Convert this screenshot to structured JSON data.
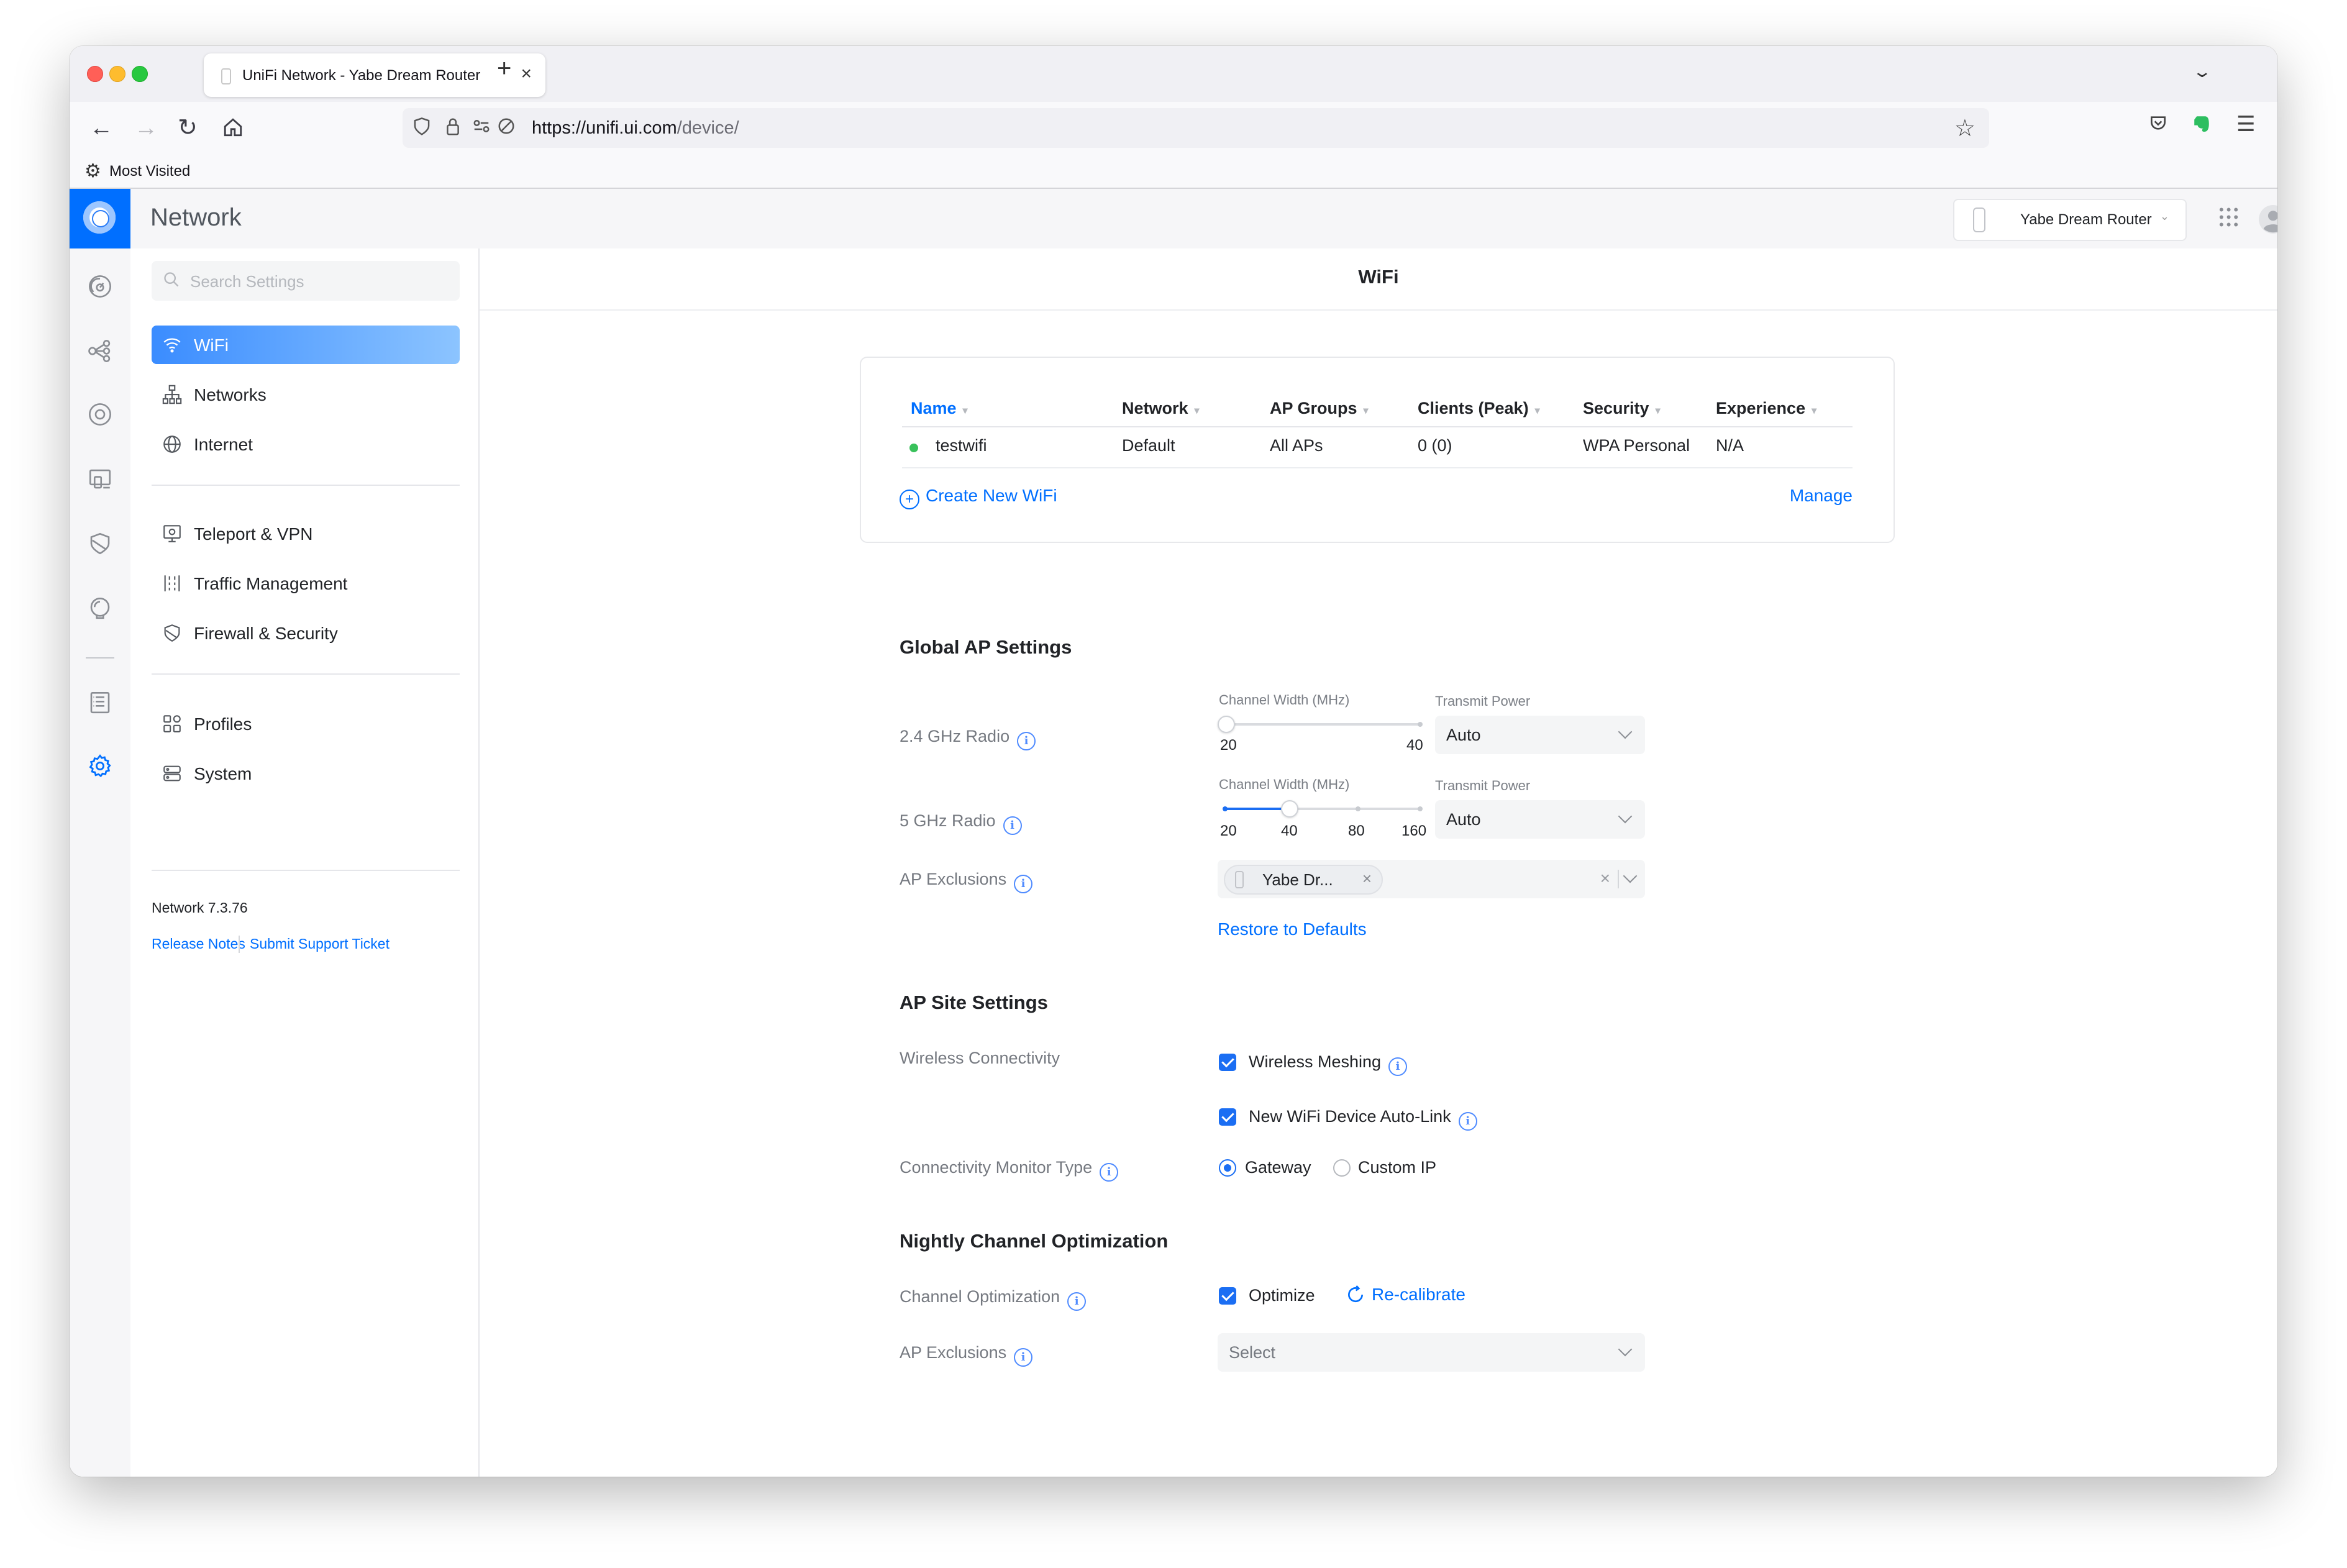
{
  "browser": {
    "tab_title": "UniFi Network - Yabe Dream Router",
    "url_host": "https://unifi.ui.com",
    "url_path": "/device/",
    "bookmark_label": "Most Visited"
  },
  "app": {
    "title": "Network",
    "device_name": "Yabe Dream Router",
    "accent_color": "#006fff"
  },
  "sidebar": {
    "search_placeholder": "Search Settings",
    "items": [
      {
        "label": "WiFi",
        "icon": "wifi-icon"
      },
      {
        "label": "Networks",
        "icon": "networks-icon"
      },
      {
        "label": "Internet",
        "icon": "globe-icon"
      },
      {
        "label": "Teleport & VPN",
        "icon": "teleport-icon"
      },
      {
        "label": "Traffic Management",
        "icon": "traffic-icon"
      },
      {
        "label": "Firewall & Security",
        "icon": "shield-icon"
      },
      {
        "label": "Profiles",
        "icon": "profiles-icon"
      },
      {
        "label": "System",
        "icon": "system-icon"
      }
    ],
    "version": "Network 7.3.76",
    "release_notes": "Release Notes",
    "support_ticket": "Submit Support Ticket"
  },
  "page": {
    "title": "WiFi"
  },
  "wifi_table": {
    "columns": [
      "Name",
      "Network",
      "AP Groups",
      "Clients (Peak)",
      "Security",
      "Experience"
    ],
    "rows": [
      {
        "name": "testwifi",
        "network": "Default",
        "ap_groups": "All APs",
        "clients": "0 (0)",
        "security": "WPA Personal",
        "experience": "N/A"
      }
    ],
    "create_label": "Create New WiFi",
    "manage_label": "Manage"
  },
  "global_ap": {
    "title": "Global AP Settings",
    "radio24": {
      "label": "2.4 GHz Radio",
      "channel_width_label": "Channel Width (MHz)",
      "ticks": [
        "20",
        "40"
      ],
      "selected_index": 0,
      "transmit_power_label": "Transmit Power",
      "transmit_power": "Auto"
    },
    "radio5": {
      "label": "5 GHz Radio",
      "channel_width_label": "Channel Width (MHz)",
      "ticks": [
        "20",
        "40",
        "80",
        "160"
      ],
      "selected_index": 1,
      "transmit_power_label": "Transmit Power",
      "transmit_power": "Auto"
    },
    "ap_exclusions_label": "AP Exclusions",
    "ap_exclusions_chip": "Yabe Dr...",
    "restore_label": "Restore to Defaults"
  },
  "ap_site": {
    "title": "AP Site Settings",
    "wireless_connectivity_label": "Wireless Connectivity",
    "wireless_meshing": "Wireless Meshing",
    "wireless_meshing_checked": true,
    "auto_link": "New WiFi Device Auto-Link",
    "auto_link_checked": true,
    "monitor_label": "Connectivity Monitor Type",
    "monitor_options": [
      "Gateway",
      "Custom IP"
    ],
    "monitor_selected": "Gateway"
  },
  "nightly": {
    "title": "Nightly Channel Optimization",
    "channel_opt_label": "Channel Optimization",
    "optimize": "Optimize",
    "optimize_checked": true,
    "recalibrate": "Re-calibrate",
    "ap_exclusions_label": "AP Exclusions",
    "select_placeholder": "Select"
  }
}
